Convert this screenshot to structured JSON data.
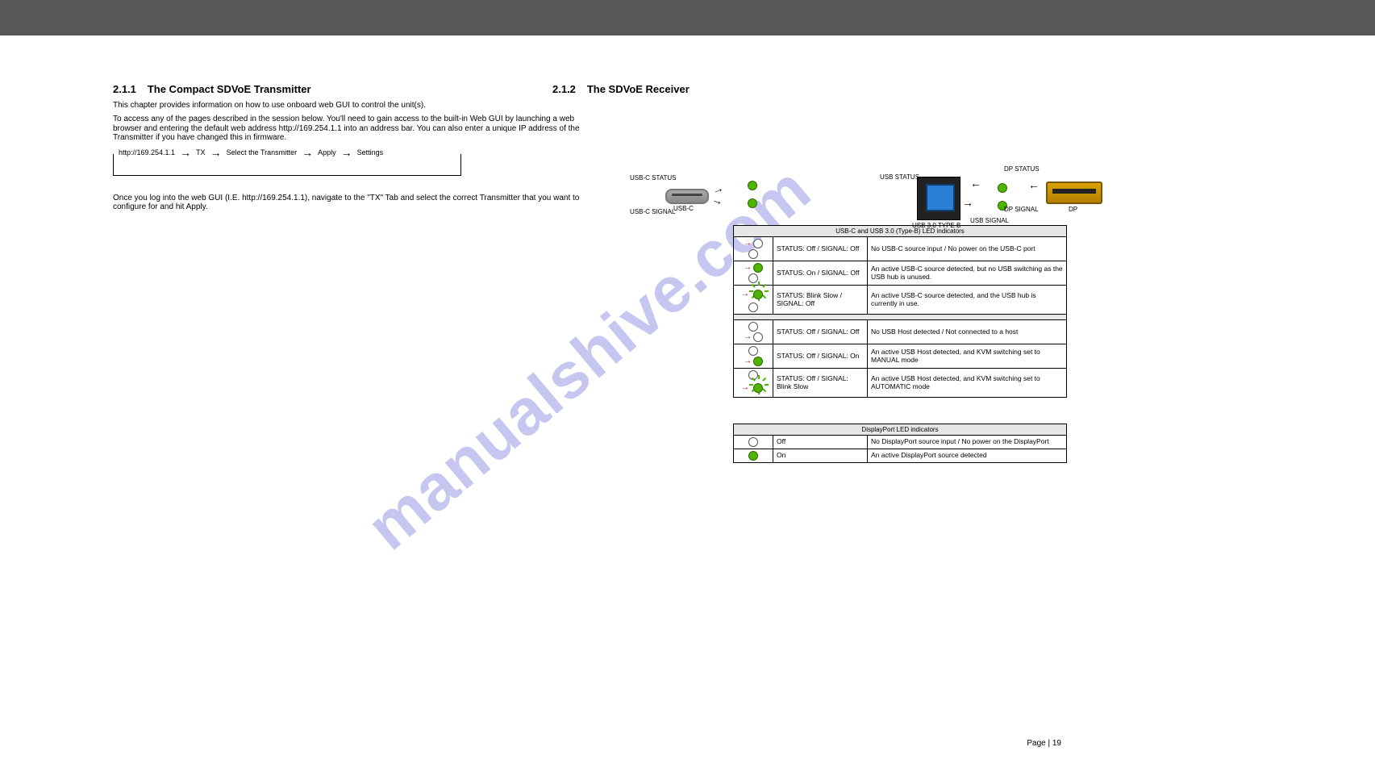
{
  "watermark": "manualshive.com",
  "left": {
    "secnum": "2.1.1",
    "sectitle": "The Compact SDVoE Transmitter",
    "p1": "This chapter provides information on how to use onboard web GUI to control the unit(s).",
    "p2": "To access any of the pages described in the session below. You'll need to gain access to the built-in Web GUI by launching a web browser and entering the default web address http://169.254.1.1 into an address bar. You can also enter a unique IP address of the Transmitter if you have changed this in firmware.",
    "p3": "Once you log into the web GUI (I.E. http://169.254.1.1), navigate to the \"TX\" Tab and select the correct Transmitter that you want to configure for and hit Apply.",
    "flow": [
      "http://169.254.1.1",
      "TX",
      "Select the Transmitter",
      "Apply",
      "Settings"
    ]
  },
  "right": {
    "secnum": "2.1.2",
    "sectitle": "The SDVoE Receiver",
    "labels": {
      "usbc_status": "USB-C STATUS",
      "usb_status": "USB STATUS",
      "usbc_signal": "USB-C SIGNAL",
      "usb_signal": "USB SIGNAL",
      "dp_status": "DP STATUS",
      "dp_signal": "DP SIGNAL",
      "usbc_port": "USB-C",
      "usb_b_port": "USB 3.0 TYPE B",
      "dp_port": "DP"
    },
    "table1_header": "USB-C and USB 3.0 (Type-B) LED indicators",
    "rows1": [
      {
        "top": {
          "arrow": true,
          "led": "off"
        },
        "bot": {
          "arrow": false,
          "led": "off"
        },
        "state": "STATUS: Off / SIGNAL: Off",
        "desc": "No USB-C source input / No power on the USB-C port"
      },
      {
        "top": {
          "arrow": true,
          "led": "on"
        },
        "bot": {
          "arrow": false,
          "led": "off"
        },
        "state": "STATUS: On / SIGNAL: Off",
        "desc": "An active USB-C source detected, but no USB switching as the USB hub is unused."
      },
      {
        "top": {
          "arrow": true,
          "led": "flash"
        },
        "bot": {
          "arrow": false,
          "led": "off"
        },
        "state": "STATUS: Blink Slow / SIGNAL: Off",
        "desc": "An active USB-C source detected, and the USB hub is currently in use."
      }
    ],
    "rows2": [
      {
        "top": {
          "arrow": false,
          "led": "off"
        },
        "bot": {
          "arrow": true,
          "led": "off"
        },
        "state": "STATUS: Off / SIGNAL: Off",
        "desc": "No USB Host detected / Not connected to a host"
      },
      {
        "top": {
          "arrow": false,
          "led": "off"
        },
        "bot": {
          "arrow": true,
          "led": "on"
        },
        "state": "STATUS: Off / SIGNAL: On",
        "desc": "An active USB Host detected, and KVM switching set to MANUAL mode"
      },
      {
        "top": {
          "arrow": false,
          "led": "off"
        },
        "bot": {
          "arrow": true,
          "led": "flash"
        },
        "state": "STATUS: Off / SIGNAL: Blink Slow",
        "desc": "An active USB Host detected, and KVM switching set to AUTOMATIC mode"
      }
    ],
    "table2_header": "DisplayPort LED indicators",
    "rows3": [
      {
        "led": "off",
        "state": "Off",
        "desc": "No DisplayPort source input / No power on the DisplayPort"
      },
      {
        "led": "on",
        "state": "On",
        "desc": "An active DisplayPort source detected"
      }
    ]
  },
  "pagenum": "Page | 19"
}
